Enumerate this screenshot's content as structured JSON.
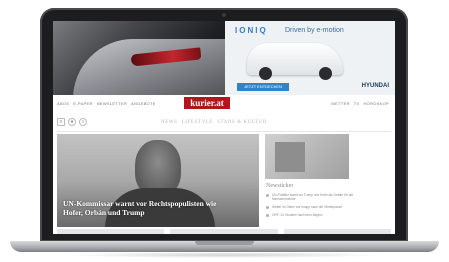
{
  "ad": {
    "headline": "IONIQ",
    "tagline": "Driven by e-motion",
    "cta": "JETZT ENTDECKEN",
    "brand": "HYUNDAI"
  },
  "nav": {
    "left_links": [
      "ABOS",
      "E-PAPER",
      "NEWSLETTER",
      "ANGEBOTE"
    ],
    "right_links": [
      "WETTER",
      "TV",
      "HOROSKOP"
    ]
  },
  "logo": "kurier.at",
  "sections": [
    "NEWS",
    "LIFESTYLE",
    "STARS & KULTUR"
  ],
  "hero": {
    "caption": "UN-Kommissar warnt vor Rechtspopulisten wie Hofer, Orbán und Trump"
  },
  "sidebar": {
    "title": "Newsticker",
    "items": [
      "UN-Politiker warnt vor Trump und Hofer als Gefahr für die Menschenrechte",
      "Wetter im Osten nur knapp nach der Winterpause",
      "ORF: 24 Stunden nach dem Beginn"
    ]
  },
  "colors": {
    "logo_bg": "#b1161c",
    "ad_accent": "#3a7bbf",
    "cta_bg": "#2f84c8"
  }
}
